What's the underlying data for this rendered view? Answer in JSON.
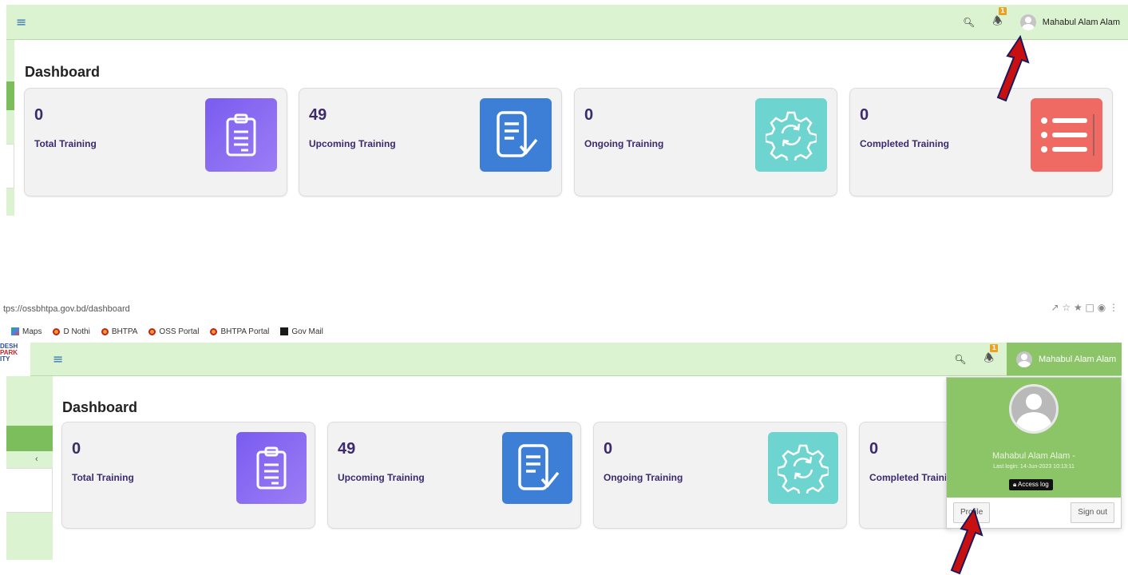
{
  "top": {
    "header": {
      "menu_icon": "hamburger-icon",
      "notif_count": "1",
      "user_name": "Mahabul Alam Alam"
    },
    "title": "Dashboard",
    "cards": [
      {
        "value": "0",
        "label": "Total Training",
        "icon": "clipboard-icon"
      },
      {
        "value": "49",
        "label": "Upcoming Training",
        "icon": "checklist-icon"
      },
      {
        "value": "0",
        "label": "Ongoing Training",
        "icon": "gear-sync-icon"
      },
      {
        "value": "0",
        "label": "Completed Training",
        "icon": "list-icon"
      }
    ]
  },
  "bottom": {
    "url": "tps://ossbhtpa.gov.bd/dashboard",
    "bookmarks": [
      "Maps",
      "D Nothi",
      "BHTPA",
      "OSS Portal",
      "BHTPA Portal",
      "Gov Mail"
    ],
    "logo_lines": [
      "DESH",
      "PARK",
      "ITY"
    ],
    "header": {
      "notif_count": "1",
      "user_name": "Mahabul Alam Alam"
    },
    "title": "Dashboard",
    "cards": [
      {
        "value": "0",
        "label": "Total Training"
      },
      {
        "value": "49",
        "label": "Upcoming Training"
      },
      {
        "value": "0",
        "label": "Ongoing Training"
      },
      {
        "value": "0",
        "label": "Completed Traini"
      }
    ],
    "dropdown": {
      "name": "Mahabul Alam Alam -",
      "last_login": "Last login: 14-Jun-2023 10:13:11",
      "access_log": "Access log",
      "profile": "Profile",
      "sign_out": "Sign out"
    }
  },
  "colors": {
    "header_bg": "#dcf3d2",
    "accent_green": "#8cc468",
    "card_text": "#3b2a6e",
    "arrow": "#c81010"
  }
}
